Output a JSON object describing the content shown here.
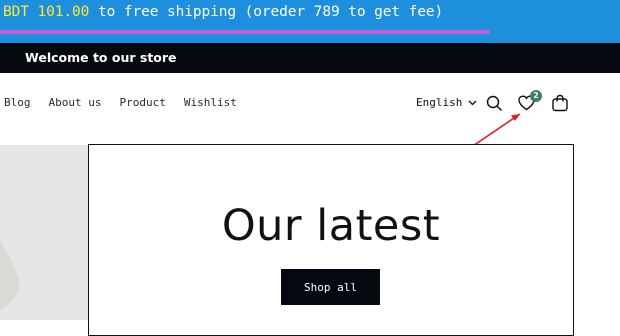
{
  "shipping_bar": {
    "amount": "BDT 101.00",
    "message": " to free shipping (oreder 789 to get fee)",
    "progress_fraction": 0.79,
    "background_color": "#1d8fdc",
    "progress_color": "#c060d8",
    "amount_color": "#ffea3b"
  },
  "announcement": {
    "text": "Welcome to our store"
  },
  "nav": {
    "items": [
      "Blog",
      "About us",
      "Product",
      "Wishlist"
    ]
  },
  "header": {
    "language": "English",
    "wishlist_count": "2",
    "icons": [
      "chevron-down-icon",
      "search-icon",
      "heart-icon",
      "cart-icon"
    ]
  },
  "hero": {
    "title": "Our latest",
    "button_label": "Shop all"
  },
  "annotation": {
    "arrow_color": "#e02020"
  }
}
